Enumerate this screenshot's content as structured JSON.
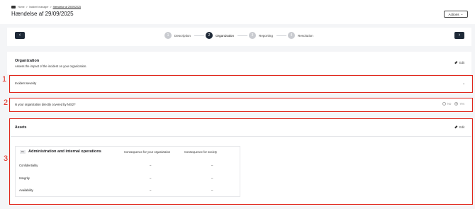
{
  "header": {
    "breadcrumb": {
      "home": "Home",
      "sep": ">",
      "section": "Incident manager",
      "current": "Hændelse af 29/09/2025"
    },
    "title": "Hændelse af 29/09/2025",
    "actions_label": "Actions",
    "actions_chevron": "⌄"
  },
  "stepper": {
    "prev_icon": "‹",
    "next_icon": "›",
    "steps": [
      {
        "num": "1",
        "label": "Description"
      },
      {
        "num": "2",
        "label": "Organization"
      },
      {
        "num": "3",
        "label": "Reporting"
      },
      {
        "num": "4",
        "label": "Resolution"
      }
    ]
  },
  "organization": {
    "title": "Organization",
    "subtitle": "Assess the impact of the incident on your organization.",
    "edit_label": "Edit"
  },
  "markers": {
    "one": "1",
    "two": "2",
    "three": "3"
  },
  "severity": {
    "label": "Incident severity",
    "chevron": "⌄"
  },
  "nis2": {
    "question": "Is your organization directly covered by NIS2?",
    "no": "No",
    "yes": "Yes"
  },
  "assets": {
    "title": "Assets",
    "edit_label": "Edit",
    "table": {
      "tag": "PA",
      "heading": "Administration and internal operations",
      "col_org": "Consequence for your organization",
      "col_society": "Consequence for society",
      "rows": [
        {
          "label": "Confidentiality",
          "org": "–",
          "society": "–"
        },
        {
          "label": "Integrity",
          "org": "–",
          "society": "–"
        },
        {
          "label": "Availability",
          "org": "–",
          "society": "–"
        }
      ]
    }
  },
  "colors": {
    "accent": "#1f2a38",
    "annotation": "#e0261b"
  }
}
